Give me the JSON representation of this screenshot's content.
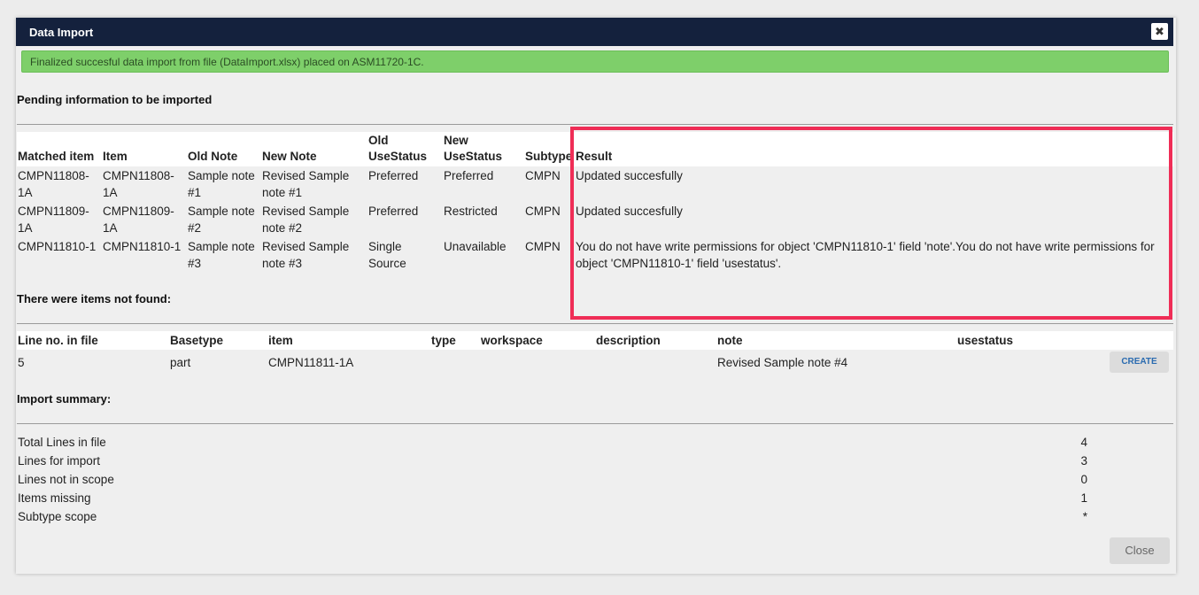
{
  "dialog": {
    "title": "Data Import",
    "close_icon": "close-icon",
    "banner": "Finalized succesful data import from file (DataImport.xlsx) placed on ASM11720-1C.",
    "banner_color": "#7ecf6a",
    "header_color": "#14213d"
  },
  "pending": {
    "title": "Pending information to be imported",
    "columns": [
      "Matched item",
      "Item",
      "Old Note",
      "New Note",
      "Old UseStatus",
      "New UseStatus",
      "Subtype",
      "Result"
    ],
    "rows": [
      [
        "CMPN11808-1A",
        "CMPN11808-1A",
        "Sample note #1",
        "Revised Sample note #1",
        "Preferred",
        "Preferred",
        "CMPN",
        "Updated succesfully"
      ],
      [
        "CMPN11809-1A",
        "CMPN11809-1A",
        "Sample note #2",
        "Revised Sample note #2",
        "Preferred",
        "Restricted",
        "CMPN",
        "Updated succesfully"
      ],
      [
        "CMPN11810-1",
        "CMPN11810-1",
        "Sample note #3",
        "Revised Sample note #3",
        "Single Source",
        "Unavailable",
        "CMPN",
        "You do not have write permissions for object 'CMPN11810-1' field 'note'.You do not have write permissions for object 'CMPN11810-1' field 'usestatus'."
      ]
    ]
  },
  "not_found": {
    "title": "There were items not found:",
    "columns": [
      "Line no. in file",
      "Basetype",
      "item",
      "type",
      "workspace",
      "description",
      "note",
      "usestatus"
    ],
    "rows": [
      [
        "5",
        "part",
        "CMPN11811-1A",
        "",
        "",
        "",
        "Revised Sample note #4",
        ""
      ]
    ],
    "create_label": "CREATE"
  },
  "summary": {
    "title": "Import summary:",
    "rows": [
      {
        "label": "Total Lines in file",
        "value": "4"
      },
      {
        "label": "Lines for import",
        "value": "3"
      },
      {
        "label": "Lines not in scope",
        "value": "0"
      },
      {
        "label": "Items missing",
        "value": "1"
      },
      {
        "label": "Subtype scope",
        "value": "*"
      }
    ]
  },
  "footer": {
    "close_label": "Close"
  },
  "highlight_color": "#ef2d56"
}
